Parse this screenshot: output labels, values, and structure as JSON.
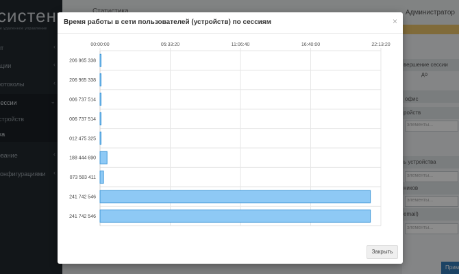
{
  "app": {
    "logo_text": "систент",
    "logo_tagline": "е удаленное управление",
    "topbar_left": "Статистика",
    "user_label": "Администратор"
  },
  "sidebar": {
    "items": [
      {
        "label": "нт",
        "chevron": "‹"
      },
      {
        "label": "ации",
        "chevron": "‹"
      },
      {
        "label": "ротоколы",
        "chevron": "‹"
      },
      {
        "label": "сессии",
        "chevron": "⌄"
      },
      {
        "label": "стройств",
        "chevron": ""
      },
      {
        "label": "ка",
        "chevron": ""
      },
      {
        "label": "ование",
        "chevron": "‹"
      },
      {
        "label": "конфигурациями",
        "chevron": "‹"
      }
    ]
  },
  "right_panel": {
    "rows": [
      "вершение сессии",
      "до",
      "офис",
      "ройств",
      "элементы...",
      "ь устройства",
      "элементы...",
      "ников",
      "элементы...",
      "email)",
      "элементы..."
    ],
    "apply_button": "Прим"
  },
  "modal": {
    "title": "Время работы в сети пользователей (устройств) по сессиям",
    "close_icon": "×",
    "close_button": "Закрыть"
  },
  "chart_data": {
    "type": "bar",
    "orientation": "horizontal",
    "x_axis_position": "top",
    "x_ticks": [
      "00:00:00",
      "05:33:20",
      "11:06:40",
      "16:40:00",
      "22:13:20"
    ],
    "x_ticks_seconds": [
      0,
      20000,
      40000,
      60000,
      80000
    ],
    "xlim": [
      0,
      80000
    ],
    "categories": [
      "206 965 338",
      "206 965 338",
      "006 737 514",
      "006 737 514",
      "012 475 325",
      "188 444 690",
      "073 583 411",
      "241 742 546",
      "241 742 546"
    ],
    "values": [
      150,
      60,
      60,
      60,
      80,
      2000,
      1000,
      77000,
      77000
    ],
    "grid": true,
    "bar_color": "#8ec9f5",
    "bar_border_color": "#3f97d8"
  }
}
